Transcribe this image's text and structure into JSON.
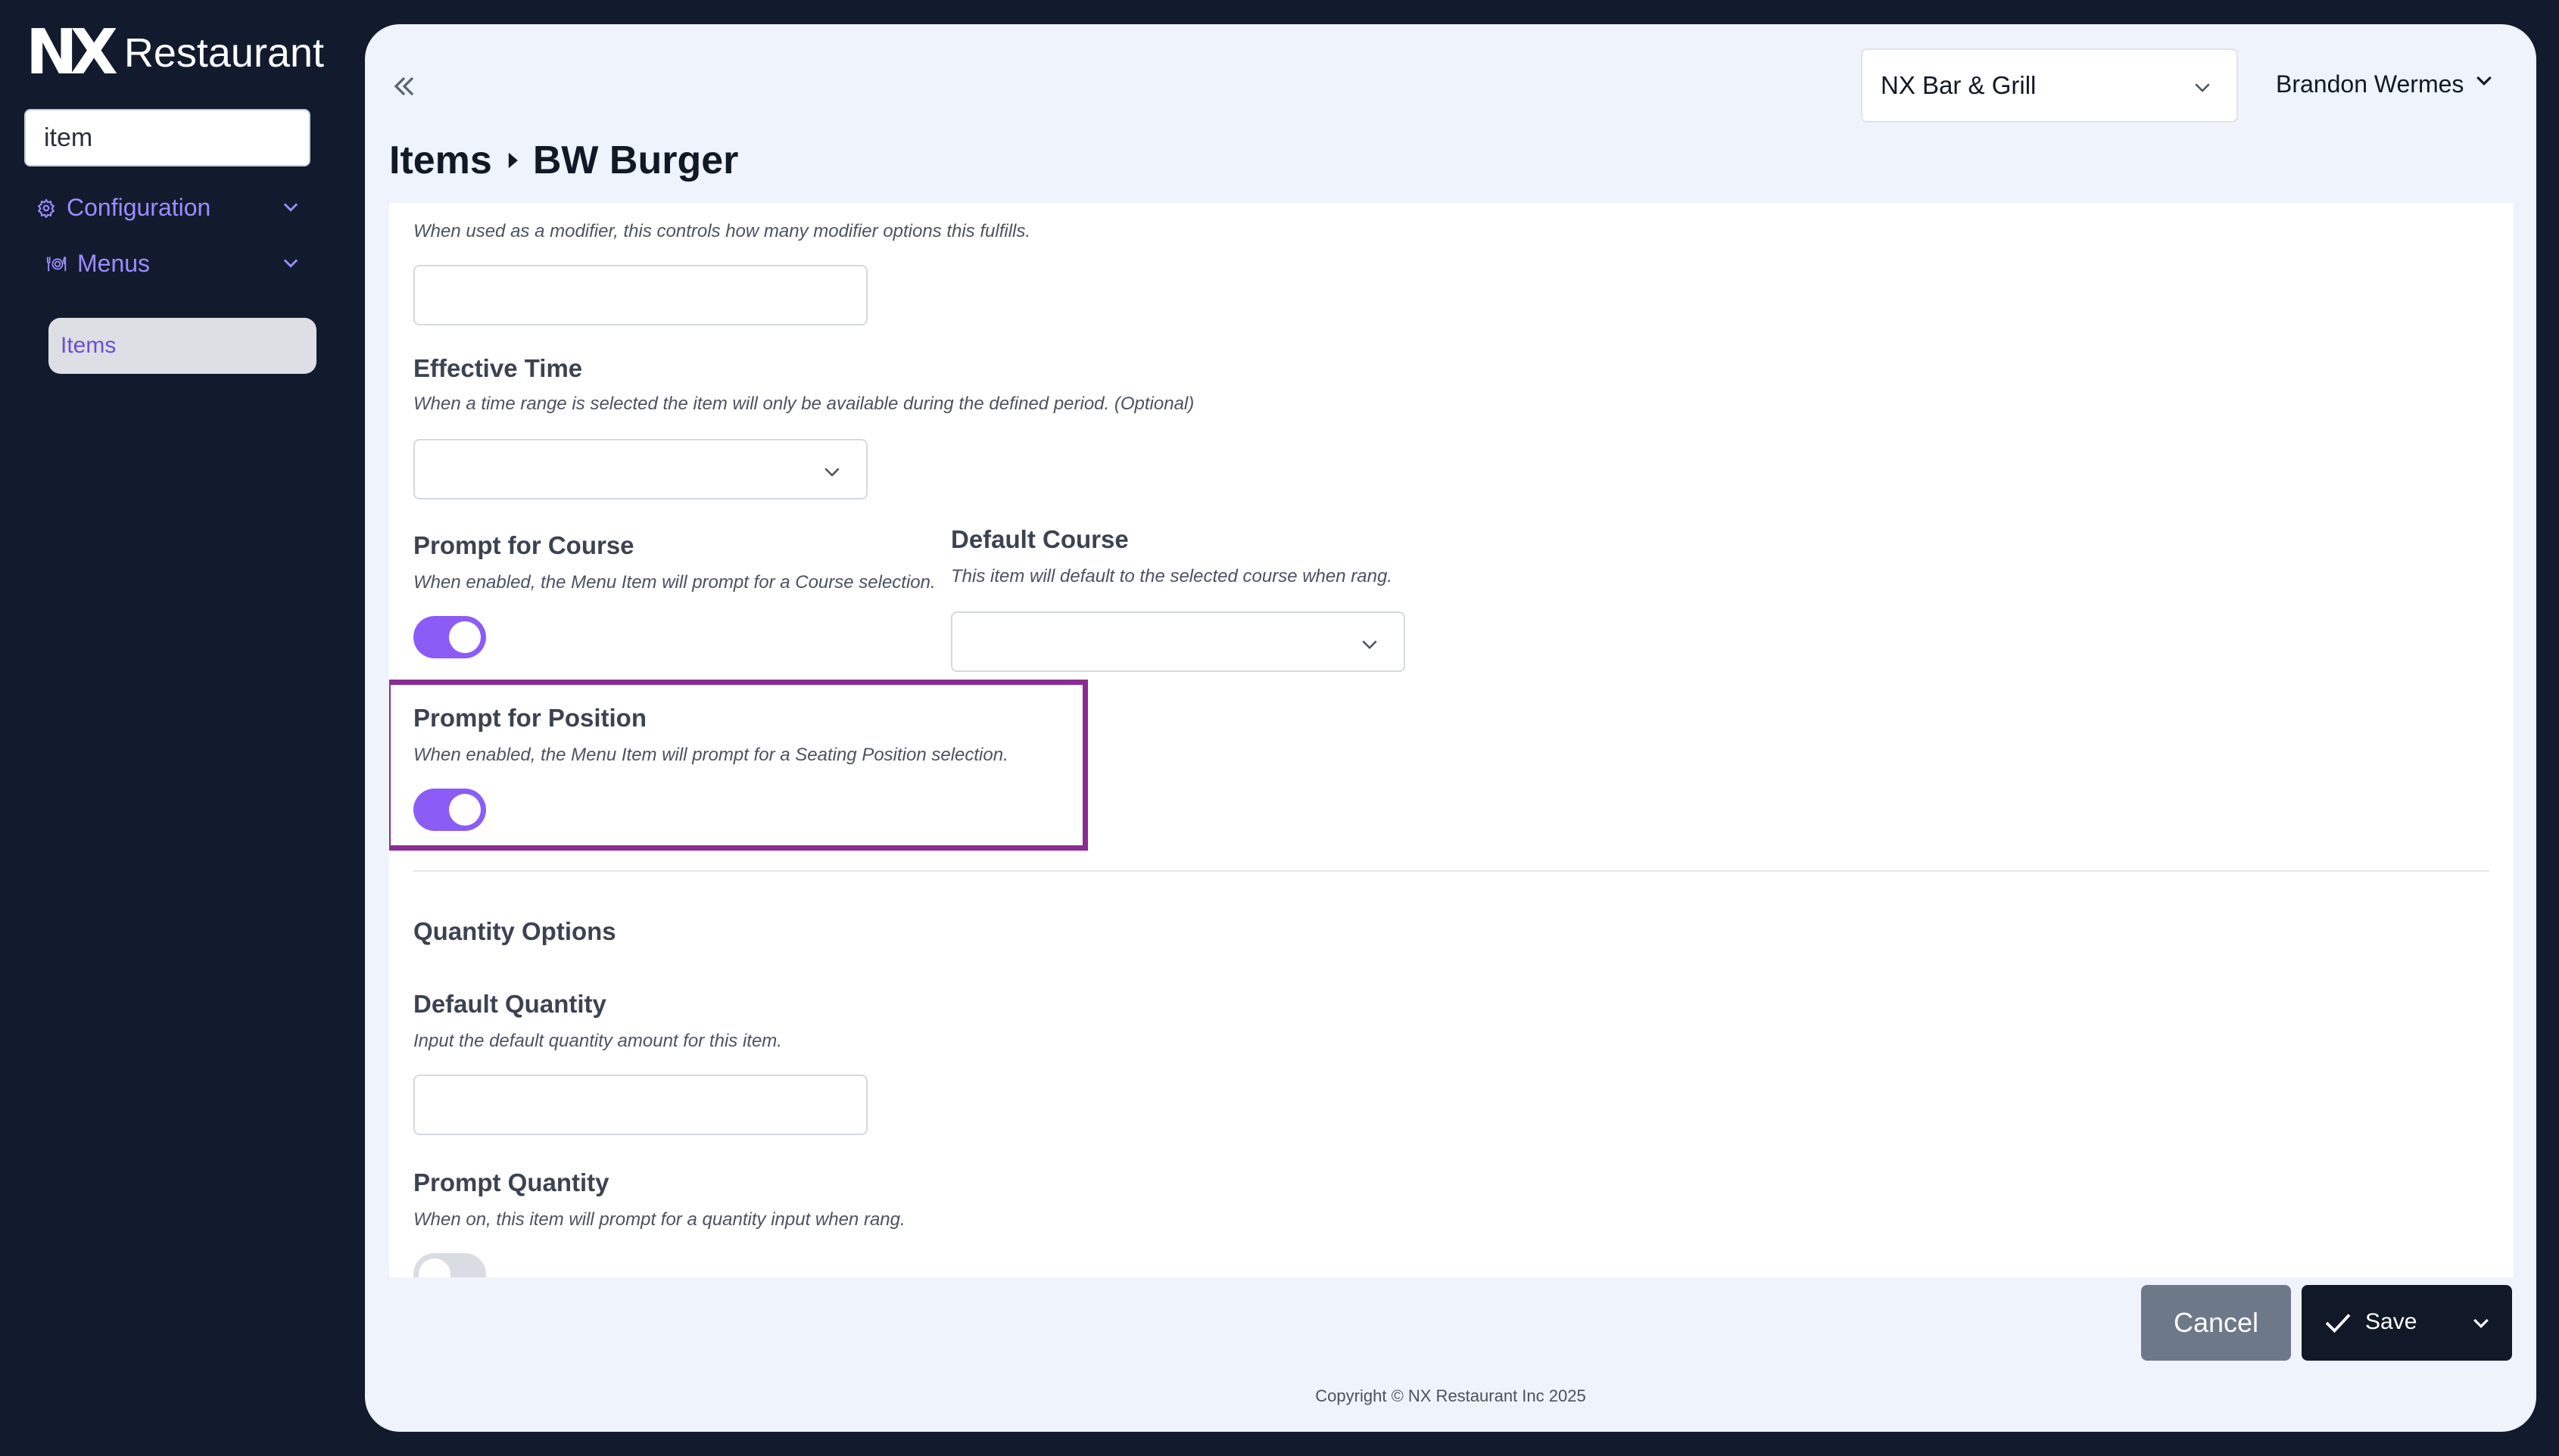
{
  "colors": {
    "background": "#121a2e",
    "accent": "#8b5cf6",
    "nav_text": "#9b8cff",
    "highlight": "#8a2c94"
  },
  "sidebar": {
    "logo_mark": "NX",
    "logo_text": "Restaurant",
    "search_value": "item",
    "nav": [
      {
        "label": "Configuration",
        "icon": "gear-icon",
        "expanded": false
      },
      {
        "label": "Menus",
        "icon": "dining-icon",
        "expanded": false
      }
    ],
    "active_item": "Items"
  },
  "header": {
    "venue": "NX Bar & Grill",
    "user": "Brandon Wermes"
  },
  "breadcrumb": {
    "parent": "Items",
    "current": "BW Burger"
  },
  "form": {
    "modifier_desc": "When used as a modifier, this controls how many modifier options this fulfills.",
    "modifier_value": "",
    "effective_time": {
      "title": "Effective Time",
      "desc": "When a time range is selected the item will only be available during the defined period. (Optional)",
      "value": ""
    },
    "prompt_course": {
      "title": "Prompt for Course",
      "desc": "When enabled, the Menu Item will prompt for a Course selection.",
      "enabled": true
    },
    "default_course": {
      "title": "Default Course",
      "desc": "This item will default to the selected course when rang.",
      "value": ""
    },
    "prompt_position": {
      "title": "Prompt for Position",
      "desc": "When enabled, the Menu Item will prompt for a Seating Position selection.",
      "enabled": true
    },
    "quantity_section": "Quantity Options",
    "default_quantity": {
      "title": "Default Quantity",
      "desc": "Input the default quantity amount for this item.",
      "value": ""
    },
    "prompt_quantity": {
      "title": "Prompt Quantity",
      "desc": "When on, this item will prompt for a quantity input when rang.",
      "enabled": false
    }
  },
  "footer": {
    "cancel": "Cancel",
    "save": "Save",
    "copyright": "Copyright © NX Restaurant Inc 2025"
  }
}
